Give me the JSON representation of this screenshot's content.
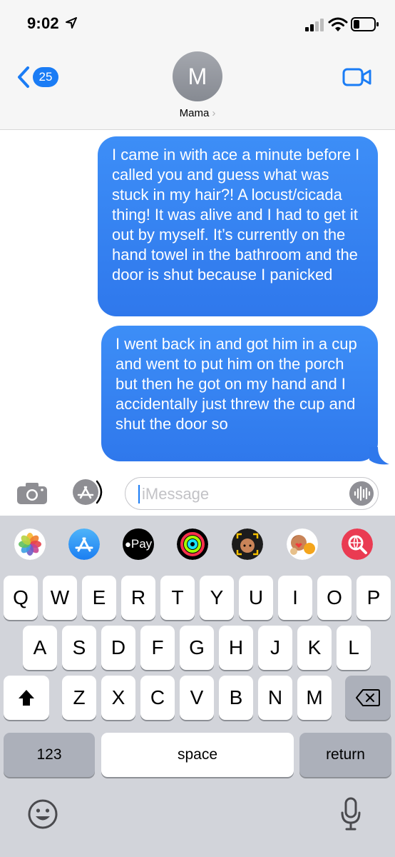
{
  "status_bar": {
    "time": "9:02",
    "location_icon": "location-arrow-icon",
    "signal_icon": "cellular-signal-icon",
    "wifi_icon": "wifi-icon",
    "battery_icon": "battery-low-icon"
  },
  "header": {
    "back_badge": "25",
    "avatar_initial": "M",
    "contact_name": "Mama",
    "contact_chevron": "›",
    "video_icon": "video-camera-icon"
  },
  "messages": [
    {
      "text": "I came in with ace a minute before I called you and guess what was stuck in my hair?! A locust/cicada thing! It was alive and I had to get it out by myself. It’s currently on the hand towel in the bathroom and the door is shut because I panicked"
    },
    {
      "text": "I went back in and got him in a cup and went to put him on the porch but then he got on my hand and I accidentally just threw the cup and shut the door so"
    }
  ],
  "compose": {
    "placeholder": "iMessage",
    "camera_icon": "camera-icon",
    "apps_icon": "app-store-icon",
    "audio_icon": "audio-waveform-icon"
  },
  "app_strip": [
    "Photos",
    "App Store",
    "Apple Pay",
    "Activity",
    "Memoji Stickers",
    "Animoji",
    "Web Search"
  ],
  "apple_pay_label": "Pay",
  "keyboard": {
    "row1": [
      "Q",
      "W",
      "E",
      "R",
      "T",
      "Y",
      "U",
      "I",
      "O",
      "P"
    ],
    "row2": [
      "A",
      "S",
      "D",
      "F",
      "G",
      "H",
      "J",
      "K",
      "L"
    ],
    "row3": [
      "Z",
      "X",
      "C",
      "V",
      "B",
      "N",
      "M"
    ],
    "numbers": "123",
    "space": "space",
    "return": "return"
  },
  "colors": {
    "bubble_blue": "#3182f0",
    "ios_blue": "#1a7cf5",
    "keyboard_bg": "#d2d4da"
  }
}
